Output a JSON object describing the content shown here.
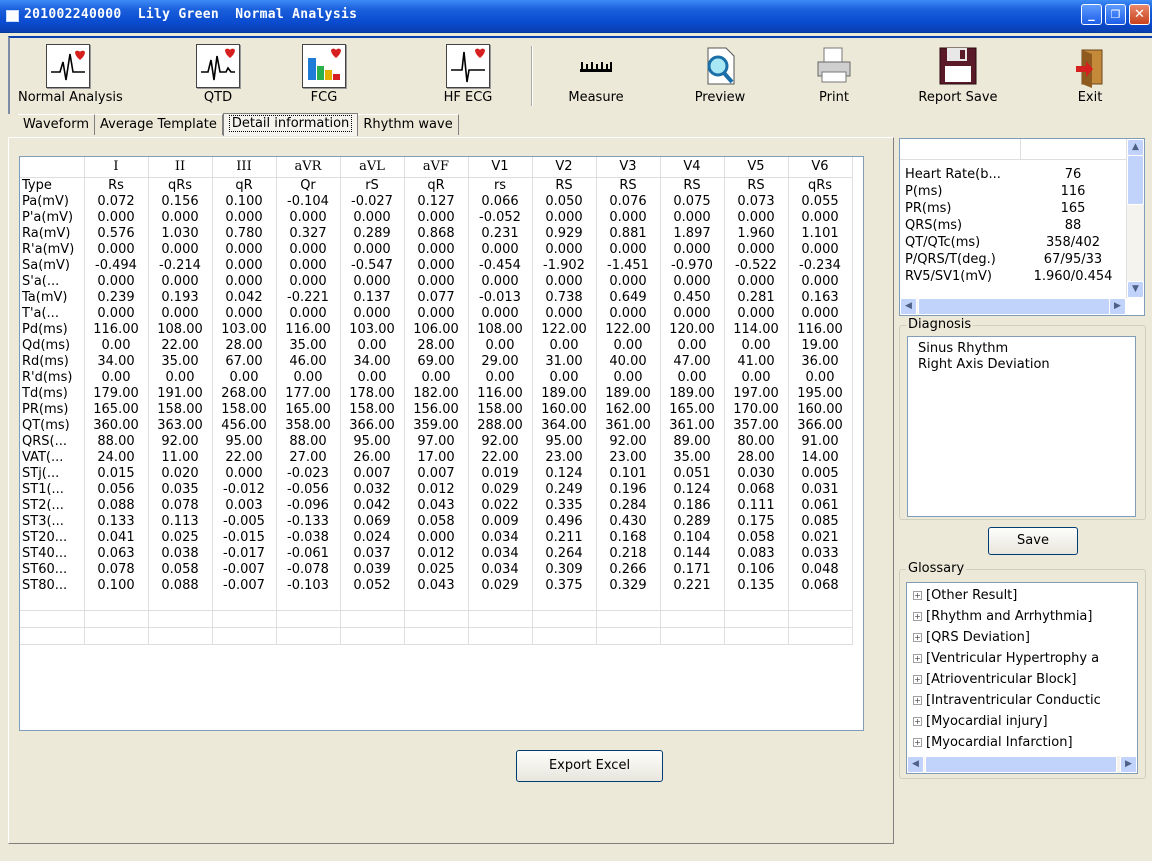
{
  "window": {
    "title": "201002240000  Lily Green  Normal Analysis",
    "minimize": "_",
    "maximize": "❐",
    "close": "✕"
  },
  "toolbar": {
    "items": [
      {
        "label": "Normal Analysis",
        "icon": "ecg-heart-icon"
      },
      {
        "label": "QTD",
        "icon": "qtd-heart-icon"
      },
      {
        "label": "FCG",
        "icon": "fcg-chart-icon"
      },
      {
        "label": "HF ECG",
        "icon": "hf-ecg-icon"
      },
      {
        "label": "Measure",
        "icon": "ruler-icon"
      },
      {
        "label": "Preview",
        "icon": "magnifier-icon"
      },
      {
        "label": "Print",
        "icon": "printer-icon"
      },
      {
        "label": "Report Save",
        "icon": "floppy-icon"
      },
      {
        "label": "Exit",
        "icon": "exit-door-icon"
      }
    ]
  },
  "tabs": [
    {
      "label": "Waveform",
      "active": false
    },
    {
      "label": "Average Template",
      "active": false
    },
    {
      "label": "Detail information",
      "active": true
    },
    {
      "label": "Rhythm wave",
      "active": false
    }
  ],
  "grid": {
    "columns": [
      "I",
      "II",
      "III",
      "aVR",
      "aVL",
      "aVF",
      "V1",
      "V2",
      "V3",
      "V4",
      "V5",
      "V6"
    ],
    "rows": [
      {
        "label": "Type",
        "values": [
          "Rs",
          "qRs",
          "qR",
          "Qr",
          "rS",
          "qR",
          "rs",
          "RS",
          "RS",
          "RS",
          "RS",
          "qRs"
        ]
      },
      {
        "label": "Pa(mV)",
        "values": [
          "0.072",
          "0.156",
          "0.100",
          "-0.104",
          "-0.027",
          "0.127",
          "0.066",
          "0.050",
          "0.076",
          "0.075",
          "0.073",
          "0.055"
        ]
      },
      {
        "label": "P'a(mV)",
        "values": [
          "0.000",
          "0.000",
          "0.000",
          "0.000",
          "0.000",
          "0.000",
          "-0.052",
          "0.000",
          "0.000",
          "0.000",
          "0.000",
          "0.000"
        ]
      },
      {
        "label": "Ra(mV)",
        "values": [
          "0.576",
          "1.030",
          "0.780",
          "0.327",
          "0.289",
          "0.868",
          "0.231",
          "0.929",
          "0.881",
          "1.897",
          "1.960",
          "1.101"
        ]
      },
      {
        "label": "R'a(mV)",
        "values": [
          "0.000",
          "0.000",
          "0.000",
          "0.000",
          "0.000",
          "0.000",
          "0.000",
          "0.000",
          "0.000",
          "0.000",
          "0.000",
          "0.000"
        ]
      },
      {
        "label": "Sa(mV)",
        "values": [
          "-0.494",
          "-0.214",
          "0.000",
          "0.000",
          "-0.547",
          "0.000",
          "-0.454",
          "-1.902",
          "-1.451",
          "-0.970",
          "-0.522",
          "-0.234"
        ]
      },
      {
        "label": "S'a(...",
        "values": [
          "0.000",
          "0.000",
          "0.000",
          "0.000",
          "0.000",
          "0.000",
          "0.000",
          "0.000",
          "0.000",
          "0.000",
          "0.000",
          "0.000"
        ]
      },
      {
        "label": "Ta(mV)",
        "values": [
          "0.239",
          "0.193",
          "0.042",
          "-0.221",
          "0.137",
          "0.077",
          "-0.013",
          "0.738",
          "0.649",
          "0.450",
          "0.281",
          "0.163"
        ]
      },
      {
        "label": "T'a(...",
        "values": [
          "0.000",
          "0.000",
          "0.000",
          "0.000",
          "0.000",
          "0.000",
          "0.000",
          "0.000",
          "0.000",
          "0.000",
          "0.000",
          "0.000"
        ]
      },
      {
        "label": "Pd(ms)",
        "values": [
          "116.00",
          "108.00",
          "103.00",
          "116.00",
          "103.00",
          "106.00",
          "108.00",
          "122.00",
          "122.00",
          "120.00",
          "114.00",
          "116.00"
        ]
      },
      {
        "label": "Qd(ms)",
        "values": [
          "0.00",
          "22.00",
          "28.00",
          "35.00",
          "0.00",
          "28.00",
          "0.00",
          "0.00",
          "0.00",
          "0.00",
          "0.00",
          "19.00"
        ]
      },
      {
        "label": "Rd(ms)",
        "values": [
          "34.00",
          "35.00",
          "67.00",
          "46.00",
          "34.00",
          "69.00",
          "29.00",
          "31.00",
          "40.00",
          "47.00",
          "41.00",
          "36.00"
        ]
      },
      {
        "label": "R'd(ms)",
        "values": [
          "0.00",
          "0.00",
          "0.00",
          "0.00",
          "0.00",
          "0.00",
          "0.00",
          "0.00",
          "0.00",
          "0.00",
          "0.00",
          "0.00"
        ]
      },
      {
        "label": "Td(ms)",
        "values": [
          "179.00",
          "191.00",
          "268.00",
          "177.00",
          "178.00",
          "182.00",
          "116.00",
          "189.00",
          "189.00",
          "189.00",
          "197.00",
          "195.00"
        ]
      },
      {
        "label": "PR(ms)",
        "values": [
          "165.00",
          "158.00",
          "158.00",
          "165.00",
          "158.00",
          "156.00",
          "158.00",
          "160.00",
          "162.00",
          "165.00",
          "170.00",
          "160.00"
        ]
      },
      {
        "label": "QT(ms)",
        "values": [
          "360.00",
          "363.00",
          "456.00",
          "358.00",
          "366.00",
          "359.00",
          "288.00",
          "364.00",
          "361.00",
          "361.00",
          "357.00",
          "366.00"
        ]
      },
      {
        "label": "QRS(...",
        "values": [
          "88.00",
          "92.00",
          "95.00",
          "88.00",
          "95.00",
          "97.00",
          "92.00",
          "95.00",
          "92.00",
          "89.00",
          "80.00",
          "91.00"
        ]
      },
      {
        "label": "VAT(...",
        "values": [
          "24.00",
          "11.00",
          "22.00",
          "27.00",
          "26.00",
          "17.00",
          "22.00",
          "23.00",
          "23.00",
          "35.00",
          "28.00",
          "14.00"
        ]
      },
      {
        "label": "STj(...",
        "values": [
          "0.015",
          "0.020",
          "0.000",
          "-0.023",
          "0.007",
          "0.007",
          "0.019",
          "0.124",
          "0.101",
          "0.051",
          "0.030",
          "0.005"
        ]
      },
      {
        "label": "ST1(...",
        "values": [
          "0.056",
          "0.035",
          "-0.012",
          "-0.056",
          "0.032",
          "0.012",
          "0.029",
          "0.249",
          "0.196",
          "0.124",
          "0.068",
          "0.031"
        ]
      },
      {
        "label": "ST2(...",
        "values": [
          "0.088",
          "0.078",
          "0.003",
          "-0.096",
          "0.042",
          "0.043",
          "0.022",
          "0.335",
          "0.284",
          "0.186",
          "0.111",
          "0.061"
        ]
      },
      {
        "label": "ST3(...",
        "values": [
          "0.133",
          "0.113",
          "-0.005",
          "-0.133",
          "0.069",
          "0.058",
          "0.009",
          "0.496",
          "0.430",
          "0.289",
          "0.175",
          "0.085"
        ]
      },
      {
        "label": "ST20...",
        "values": [
          "0.041",
          "0.025",
          "-0.015",
          "-0.038",
          "0.024",
          "0.000",
          "0.034",
          "0.211",
          "0.168",
          "0.104",
          "0.058",
          "0.021"
        ]
      },
      {
        "label": "ST40...",
        "values": [
          "0.063",
          "0.038",
          "-0.017",
          "-0.061",
          "0.037",
          "0.012",
          "0.034",
          "0.264",
          "0.218",
          "0.144",
          "0.083",
          "0.033"
        ]
      },
      {
        "label": "ST60...",
        "values": [
          "0.078",
          "0.058",
          "-0.007",
          "-0.078",
          "0.039",
          "0.025",
          "0.034",
          "0.309",
          "0.266",
          "0.171",
          "0.106",
          "0.048"
        ]
      },
      {
        "label": "ST80...",
        "values": [
          "0.100",
          "0.088",
          "-0.007",
          "-0.103",
          "0.052",
          "0.043",
          "0.029",
          "0.375",
          "0.329",
          "0.221",
          "0.135",
          "0.068"
        ]
      }
    ]
  },
  "export_button": "Export Excel",
  "summary": {
    "rows": [
      {
        "key": "Heart Rate(b...",
        "value": "76"
      },
      {
        "key": "P(ms)",
        "value": "116"
      },
      {
        "key": "PR(ms)",
        "value": "165"
      },
      {
        "key": "QRS(ms)",
        "value": "88"
      },
      {
        "key": "QT/QTc(ms)",
        "value": "358/402"
      },
      {
        "key": "P/QRS/T(deg.)",
        "value": "67/95/33"
      },
      {
        "key": "RV5/SV1(mV)",
        "value": "1.960/0.454"
      }
    ]
  },
  "diagnosis": {
    "title": "Diagnosis",
    "lines": [
      "Sinus Rhythm",
      "Right Axis Deviation"
    ]
  },
  "save_button": "Save",
  "glossary": {
    "title": "Glossary",
    "items": [
      "[Other Result]",
      "[Rhythm and Arrhythmia]",
      "[QRS Deviation]",
      "[Ventricular Hypertrophy a",
      "[Atrioventricular Block]",
      "[Intraventricular Conductic",
      "[Myocardial injury]",
      "[Myocardial Infarction]"
    ]
  },
  "scrollbar": {
    "up": "▲",
    "down": "▼",
    "left": "◀",
    "right": "▶"
  },
  "colors": {
    "titlebar": "#0a4bd0",
    "window_bg": "#ece9d8",
    "accent_red": "#d62020"
  }
}
